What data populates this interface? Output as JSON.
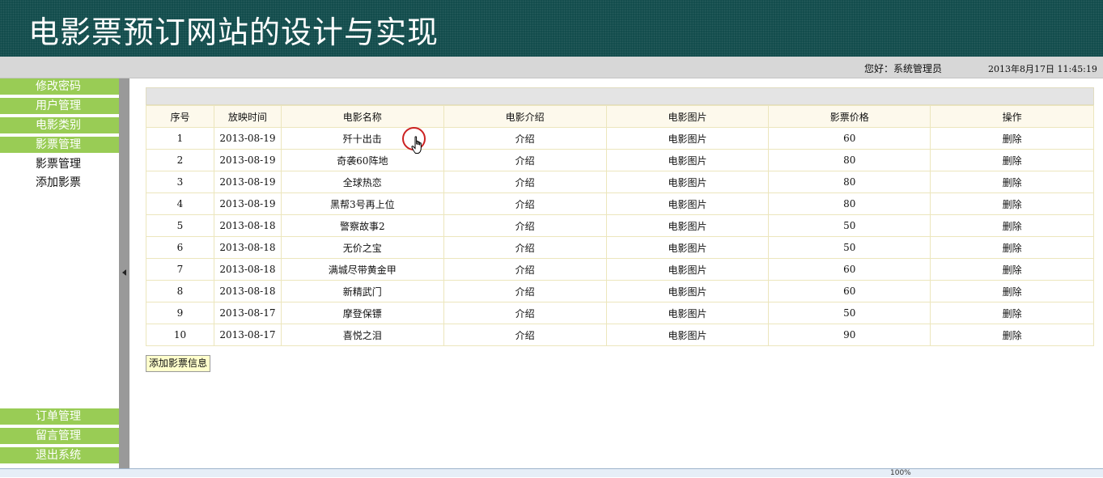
{
  "header": {
    "title": "电影票预订网站的设计与实现"
  },
  "info_bar": {
    "greeting": "您好：系统管理员",
    "datetime": "2013年8月17日  11:45:19"
  },
  "sidebar": {
    "top_items": [
      "修改密码",
      "用户管理",
      "电影类别",
      "影票管理"
    ],
    "sub_items": [
      "影票管理",
      "添加影票"
    ],
    "bottom_items": [
      "订单管理",
      "留言管理",
      "退出系统"
    ]
  },
  "table": {
    "headers": [
      "序号",
      "放映时间",
      "电影名称",
      "电影介绍",
      "电影图片",
      "影票价格",
      "操作"
    ],
    "rows": [
      [
        "1",
        "2013-08-19",
        "歼十出击",
        "介绍",
        "电影图片",
        "60",
        "删除"
      ],
      [
        "2",
        "2013-08-19",
        "奇袭60阵地",
        "介绍",
        "电影图片",
        "80",
        "删除"
      ],
      [
        "3",
        "2013-08-19",
        "全球热恋",
        "介绍",
        "电影图片",
        "80",
        "删除"
      ],
      [
        "4",
        "2013-08-19",
        "黑帮3号再上位",
        "介绍",
        "电影图片",
        "80",
        "删除"
      ],
      [
        "5",
        "2013-08-18",
        "警察故事2",
        "介绍",
        "电影图片",
        "50",
        "删除"
      ],
      [
        "6",
        "2013-08-18",
        "无价之宝",
        "介绍",
        "电影图片",
        "50",
        "删除"
      ],
      [
        "7",
        "2013-08-18",
        "满城尽带黄金甲",
        "介绍",
        "电影图片",
        "60",
        "删除"
      ],
      [
        "8",
        "2013-08-18",
        "新精武门",
        "介绍",
        "电影图片",
        "60",
        "删除"
      ],
      [
        "9",
        "2013-08-17",
        "摩登保镖",
        "介绍",
        "电影图片",
        "50",
        "删除"
      ],
      [
        "10",
        "2013-08-17",
        "喜悦之泪",
        "介绍",
        "电影图片",
        "90",
        "删除"
      ]
    ]
  },
  "actions": {
    "add_button": "添加影票信息"
  },
  "status_bar": {
    "zoom": "100%"
  },
  "colors": {
    "header_bg": "#0f4a4a",
    "menu_bg": "#99cc55",
    "table_border": "#ece6bd",
    "button_bg": "#ffffcc"
  },
  "icons": [
    "hand-cursor-icon",
    "collapse-arrow-icon",
    "speaker-icon",
    "zoom-icon"
  ]
}
